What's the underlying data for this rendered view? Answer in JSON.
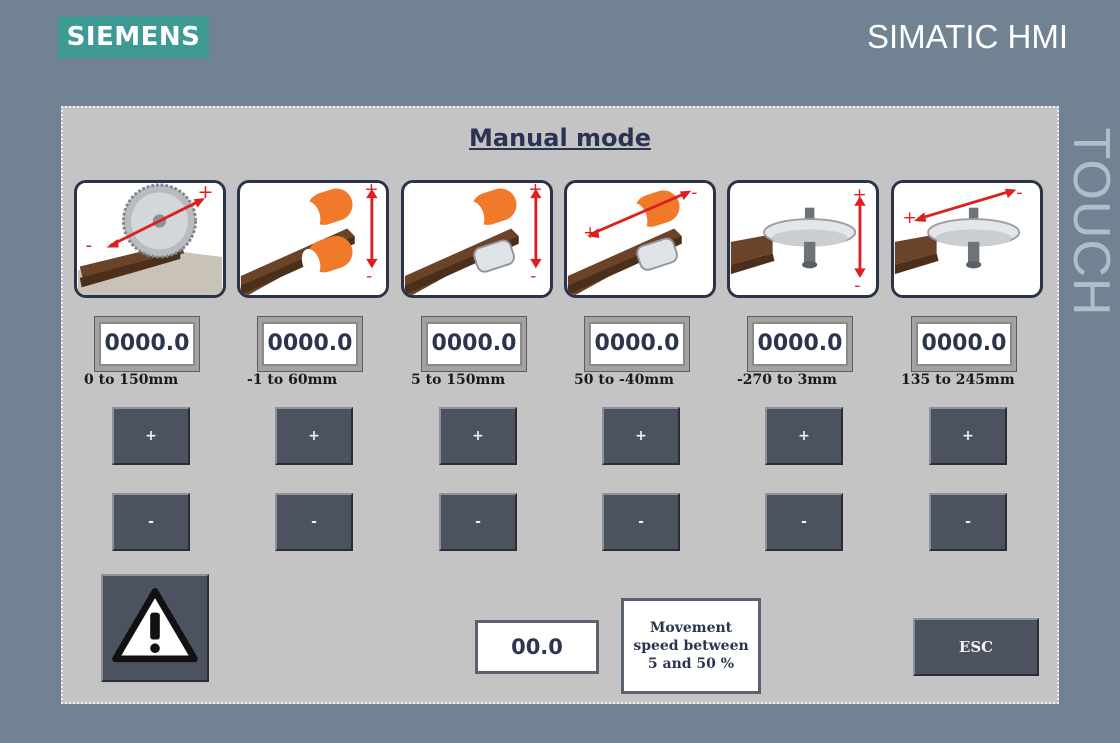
{
  "header": {
    "brand": "SIEMENS",
    "product": "SIMATIC HMI",
    "side_label": "TOUCH"
  },
  "screen": {
    "title": "Manual mode",
    "axes": [
      {
        "value": "0000.0",
        "range": "0 to 150mm",
        "plus_label": "+",
        "minus_label": "-",
        "tile_icon": "saw-blade-traverse-icon",
        "arrow_plus": "+",
        "arrow_minus": "-"
      },
      {
        "value": "0000.0",
        "range": "-1 to 60mm",
        "plus_label": "+",
        "minus_label": "-",
        "tile_icon": "feed-rollers-vertical-icon",
        "arrow_plus": "+",
        "arrow_minus": "-"
      },
      {
        "value": "0000.0",
        "range": "5 to 150mm",
        "plus_label": "+",
        "minus_label": "-",
        "tile_icon": "pressure-roller-vertical-icon",
        "arrow_plus": "+",
        "arrow_minus": "-"
      },
      {
        "value": "0000.0",
        "range": "50 to -40mm",
        "plus_label": "+",
        "minus_label": "-",
        "tile_icon": "pressure-roller-traverse-icon",
        "arrow_plus": "+",
        "arrow_minus": "-"
      },
      {
        "value": "0000.0",
        "range": "-270 to 3mm",
        "plus_label": "+",
        "minus_label": "-",
        "tile_icon": "cutter-head-vertical-icon",
        "arrow_plus": "+",
        "arrow_minus": "-"
      },
      {
        "value": "0000.0",
        "range": "135 to 245mm",
        "plus_label": "+",
        "minus_label": "-",
        "tile_icon": "cutter-head-traverse-icon",
        "arrow_plus": "+",
        "arrow_minus": "-"
      }
    ],
    "speed_value": "00.0",
    "speed_hint": "Movement speed between 5 and 50 %",
    "esc_label": "ESC",
    "warning_icon": "warning-icon"
  },
  "colors": {
    "frame_bg": "#718393",
    "screen_bg": "#c4c4c4",
    "brand_bg": "#3f9a96",
    "button_bg": "#4c5260",
    "title_text": "#2a3452",
    "arrow": "#dd1f1f",
    "roller": "#f07a2a",
    "wood": "#6a4328"
  }
}
